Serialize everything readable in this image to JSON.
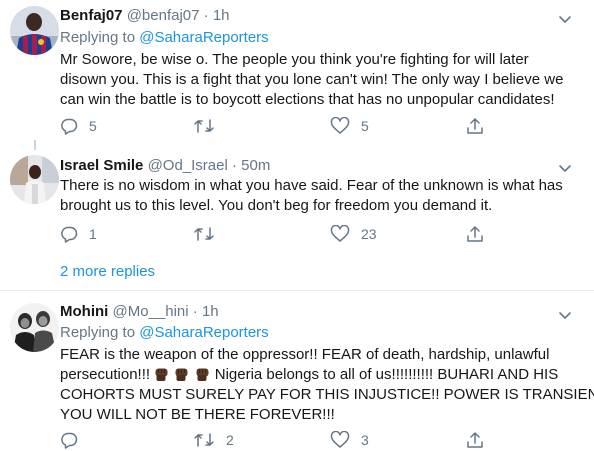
{
  "tweets": [
    {
      "name": "Benfaj07",
      "handle": "@benfaj07",
      "time": "1h",
      "replying_prefix": "Replying to",
      "replying_to": "@SaharaReporters",
      "lines": [
        "Mr Sowore, be wise o. The people you think you're fighting for will later",
        "disown you. This is a fight that you lone can't win! The only way I believe we",
        "can win the battle is to boycott elections that has no unpopular candidates!"
      ],
      "replies": "5",
      "retweets": "",
      "likes": "5"
    },
    {
      "name": "Israel Smile",
      "handle": "@Od_Israel",
      "time": "50m",
      "lines": [
        "There is no wisdom in what you have said. Fear of the unknown is what has",
        "brought us to this level. You don't beg for freedom you demand it."
      ],
      "replies": "1",
      "retweets": "",
      "likes": "23"
    },
    {
      "name": "Mohini",
      "handle": "@Mo__hini",
      "time": "1h",
      "replying_prefix": "Replying to",
      "replying_to": "@SaharaReporters",
      "lines": [
        "FEAR is the weapon of the oppressor!! FEAR of death, hardship,  unlawful",
        "persecution!!!",
        "Nigeria belongs to all of us!!!!!!!!!! BUHARI AND HIS",
        "COHORTS MUST SURELY PAY FOR THIS INJUSTICE!! POWER IS TRANSIENT",
        "YOU WILL NOT BE THERE FOREVER!!!"
      ],
      "replies": "",
      "retweets": "2",
      "likes": "3"
    }
  ],
  "more_replies": "2 more replies",
  "separator": "·",
  "icons": {
    "reply": "reply-icon",
    "retweet": "retweet-icon",
    "like": "heart-icon",
    "share": "share-icon",
    "more": "chevron-down-icon",
    "raised_fist": "raised-fist-emoji"
  },
  "colors": {
    "text": "#14171a",
    "secondary": "#657786",
    "link": "#1b95e0",
    "divider": "#e6ecf0",
    "thread_line": "#ccd6dd"
  }
}
